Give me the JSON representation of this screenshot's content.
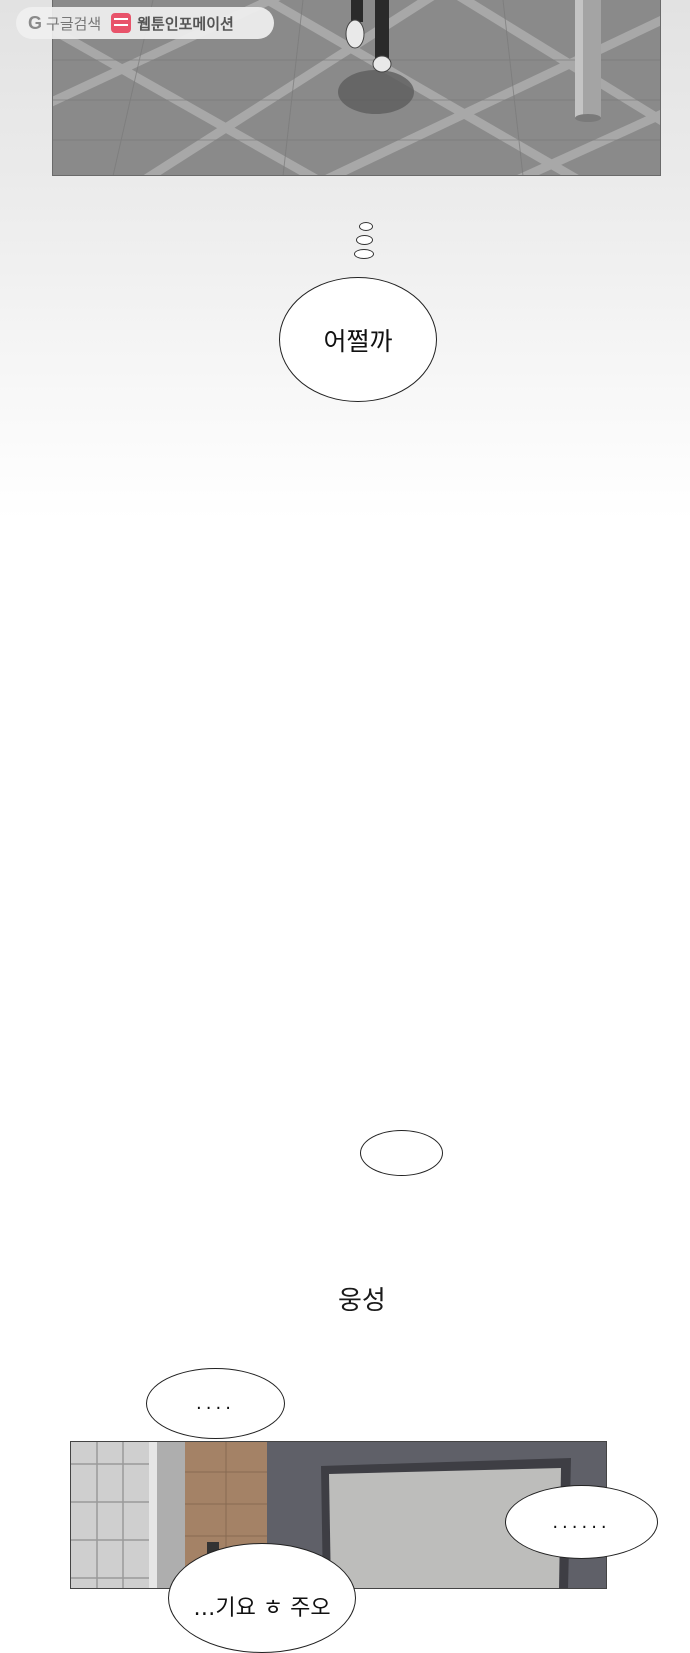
{
  "watermark": {
    "google_label": "구글검색",
    "site_label": "웹툰인포메이션"
  },
  "dialogue": {
    "thought": "어쩔까",
    "empty_bubble": "",
    "sfx": "웅성",
    "ellipsis_1": "....",
    "ellipsis_2": "......",
    "cut_bubble": "…기요 ㅎ 주오"
  }
}
